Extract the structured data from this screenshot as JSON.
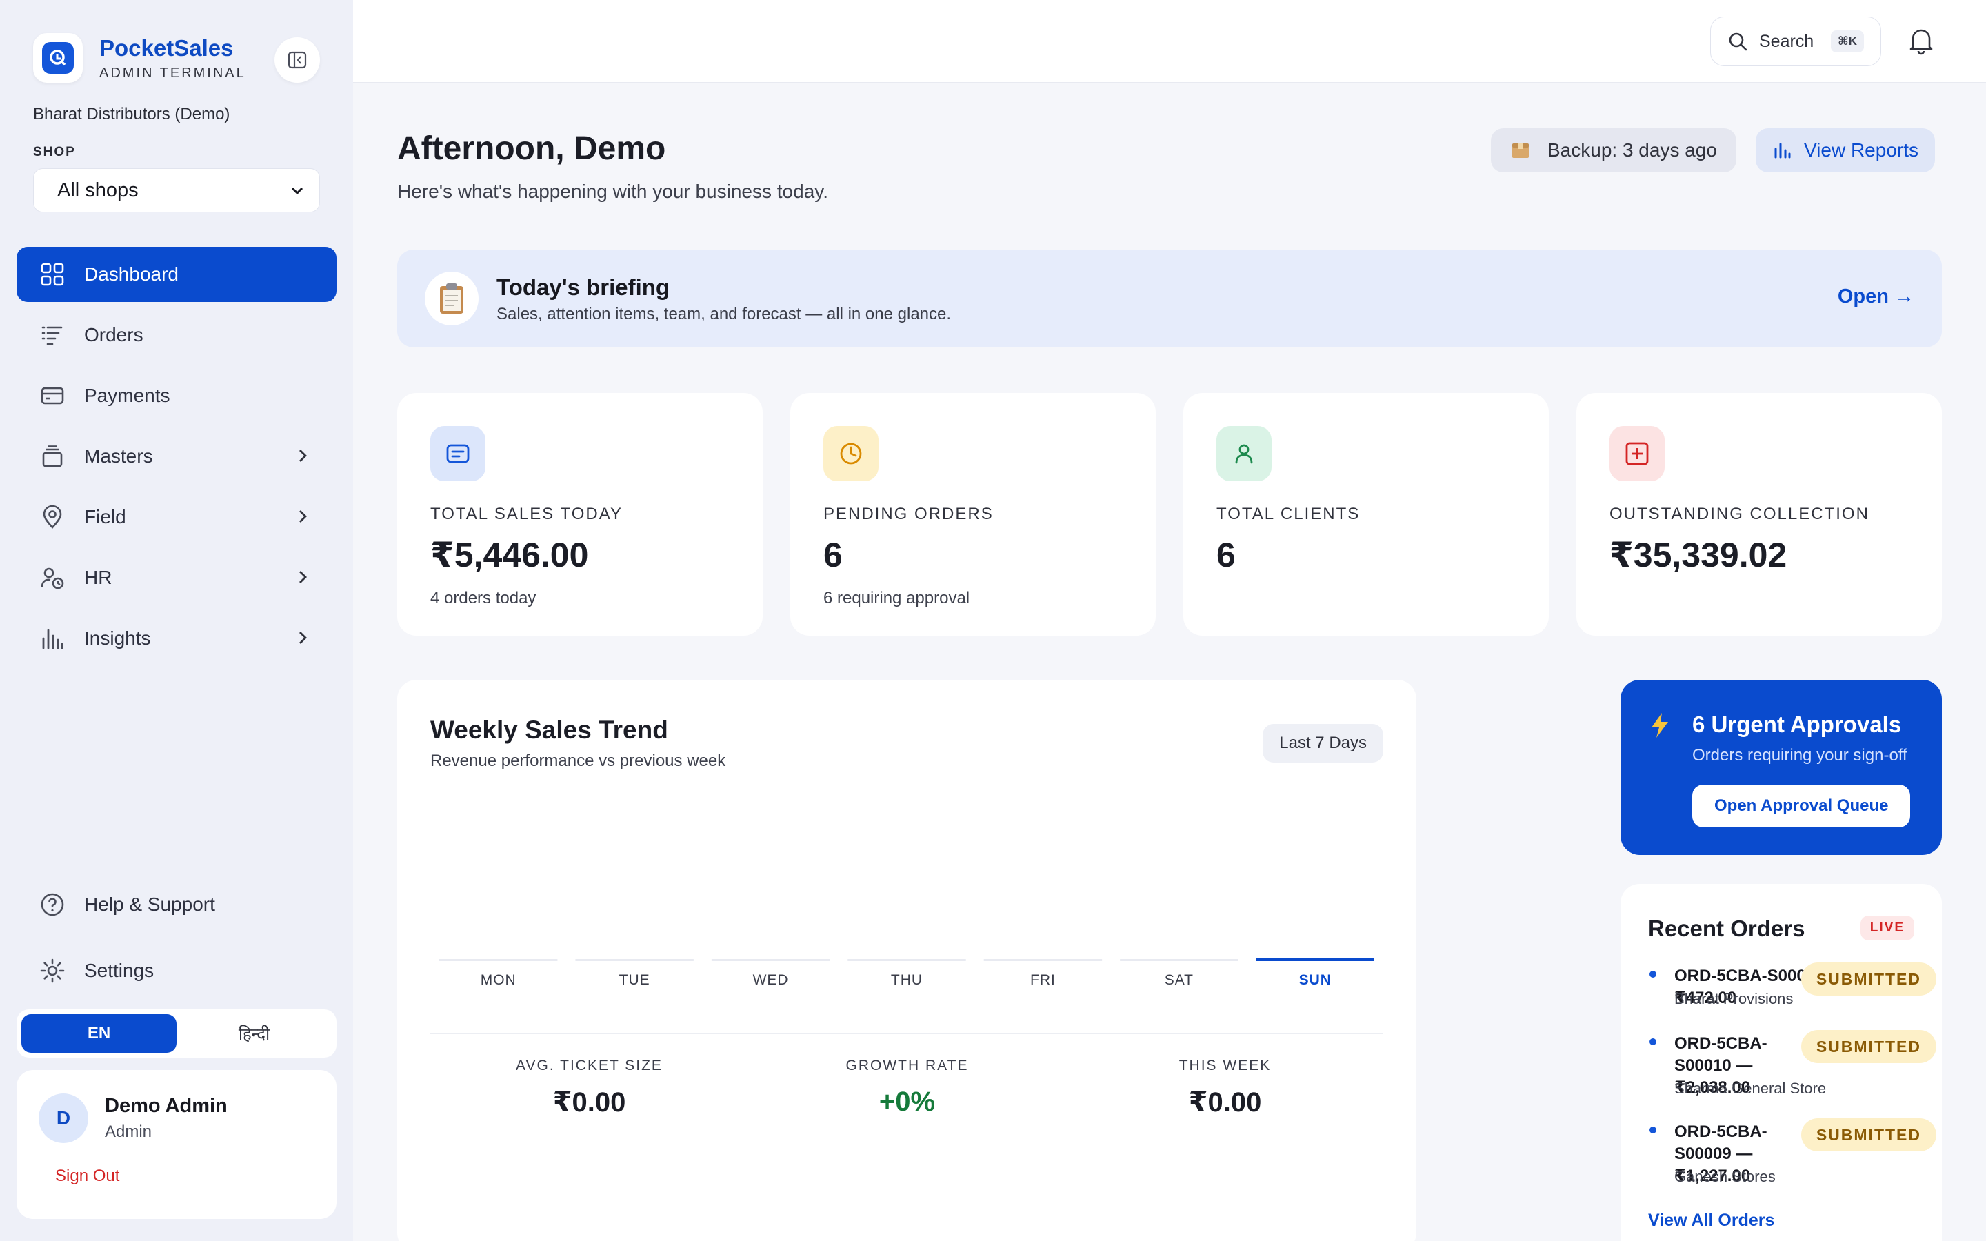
{
  "brand": {
    "name": "PocketSales",
    "subtitle": "ADMIN TERMINAL"
  },
  "org": {
    "name": "Bharat Distributors (Demo)"
  },
  "shop": {
    "label": "SHOP",
    "selected": "All shops"
  },
  "nav": {
    "items": [
      {
        "label": "Dashboard",
        "icon": "grid-icon",
        "active": true
      },
      {
        "label": "Orders",
        "icon": "list-filter-icon"
      },
      {
        "label": "Payments",
        "icon": "card-icon"
      },
      {
        "label": "Masters",
        "icon": "box-icon",
        "expandable": true
      },
      {
        "label": "Field",
        "icon": "map-pin-icon",
        "expandable": true
      },
      {
        "label": "HR",
        "icon": "user-clock-icon",
        "expandable": true
      },
      {
        "label": "Insights",
        "icon": "bar-chart-icon",
        "expandable": true
      }
    ],
    "bottom": [
      {
        "label": "Help & Support",
        "icon": "help-circle-icon"
      },
      {
        "label": "Settings",
        "icon": "gear-icon"
      }
    ]
  },
  "language": {
    "en": "EN",
    "hi": "हिन्दी",
    "selected": "EN"
  },
  "user": {
    "initial": "D",
    "name": "Demo Admin",
    "role": "Admin",
    "signout": "Sign Out"
  },
  "topbar": {
    "search_label": "Search",
    "shortcut": "⌘K"
  },
  "header": {
    "greeting": "Afternoon, Demo",
    "subtitle": "Here's what's happening with your business today.",
    "backup": "Backup: 3 days ago",
    "reports": "View Reports"
  },
  "briefing": {
    "title": "Today's briefing",
    "subtitle": "Sales, attention items, team, and forecast — all in one glance.",
    "action": "Open →"
  },
  "stats": [
    {
      "label": "TOTAL SALES TODAY",
      "value": "₹5,446.00",
      "sub": "4 orders today",
      "icon": "receipt-icon",
      "color": "#DCE6FB",
      "icon_color": "#1456D9"
    },
    {
      "label": "PENDING ORDERS",
      "value": "6",
      "sub": "6 requiring approval",
      "icon": "clock-icon",
      "color": "#FDF0C8",
      "icon_color": "#D98A00"
    },
    {
      "label": "TOTAL CLIENTS",
      "value": "6",
      "sub": "",
      "icon": "user-icon",
      "color": "#DAF3E6",
      "icon_color": "#1D8A4E"
    },
    {
      "label": "OUTSTANDING COLLECTION",
      "value": "₹35,339.02",
      "sub": "",
      "icon": "plus-square-icon",
      "color": "#FCE3E3",
      "icon_color": "#D42525"
    }
  ],
  "trend": {
    "title": "Weekly Sales Trend",
    "subtitle": "Revenue performance vs previous week",
    "range": "Last 7 Days",
    "metrics": [
      {
        "label": "AVG. TICKET SIZE",
        "value": "₹0.00"
      },
      {
        "label": "GROWTH RATE",
        "value": "+0%",
        "highlight": "green"
      },
      {
        "label": "THIS WEEK",
        "value": "₹0.00"
      }
    ]
  },
  "chart_data": {
    "type": "bar",
    "categories": [
      "MON",
      "TUE",
      "WED",
      "THU",
      "FRI",
      "SAT",
      "SUN"
    ],
    "values": [
      0,
      0,
      0,
      0,
      0,
      0,
      0
    ],
    "highlighted_category": "SUN",
    "highlight_color": "#0A4BCE",
    "base_color": "#E8EAF1"
  },
  "urgent": {
    "title": "6 Urgent Approvals",
    "subtitle": "Orders requiring your sign-off",
    "action": "Open Approval Queue"
  },
  "recent_orders": {
    "title": "Recent Orders",
    "badge": "LIVE",
    "items": [
      {
        "id": "ORD-5CBA-S00011 — ₹472.00",
        "client": "Bharat Provisions",
        "status": "SUBMITTED"
      },
      {
        "id": "ORD-5CBA-S00010 — ₹2,038.00",
        "client": "Sharma General Store",
        "status": "SUBMITTED"
      },
      {
        "id": "ORD-5CBA-S00009 — ₹1,227.00",
        "client": "Ganesh Stores",
        "status": "SUBMITTED"
      }
    ],
    "view_all": "View All Orders"
  }
}
